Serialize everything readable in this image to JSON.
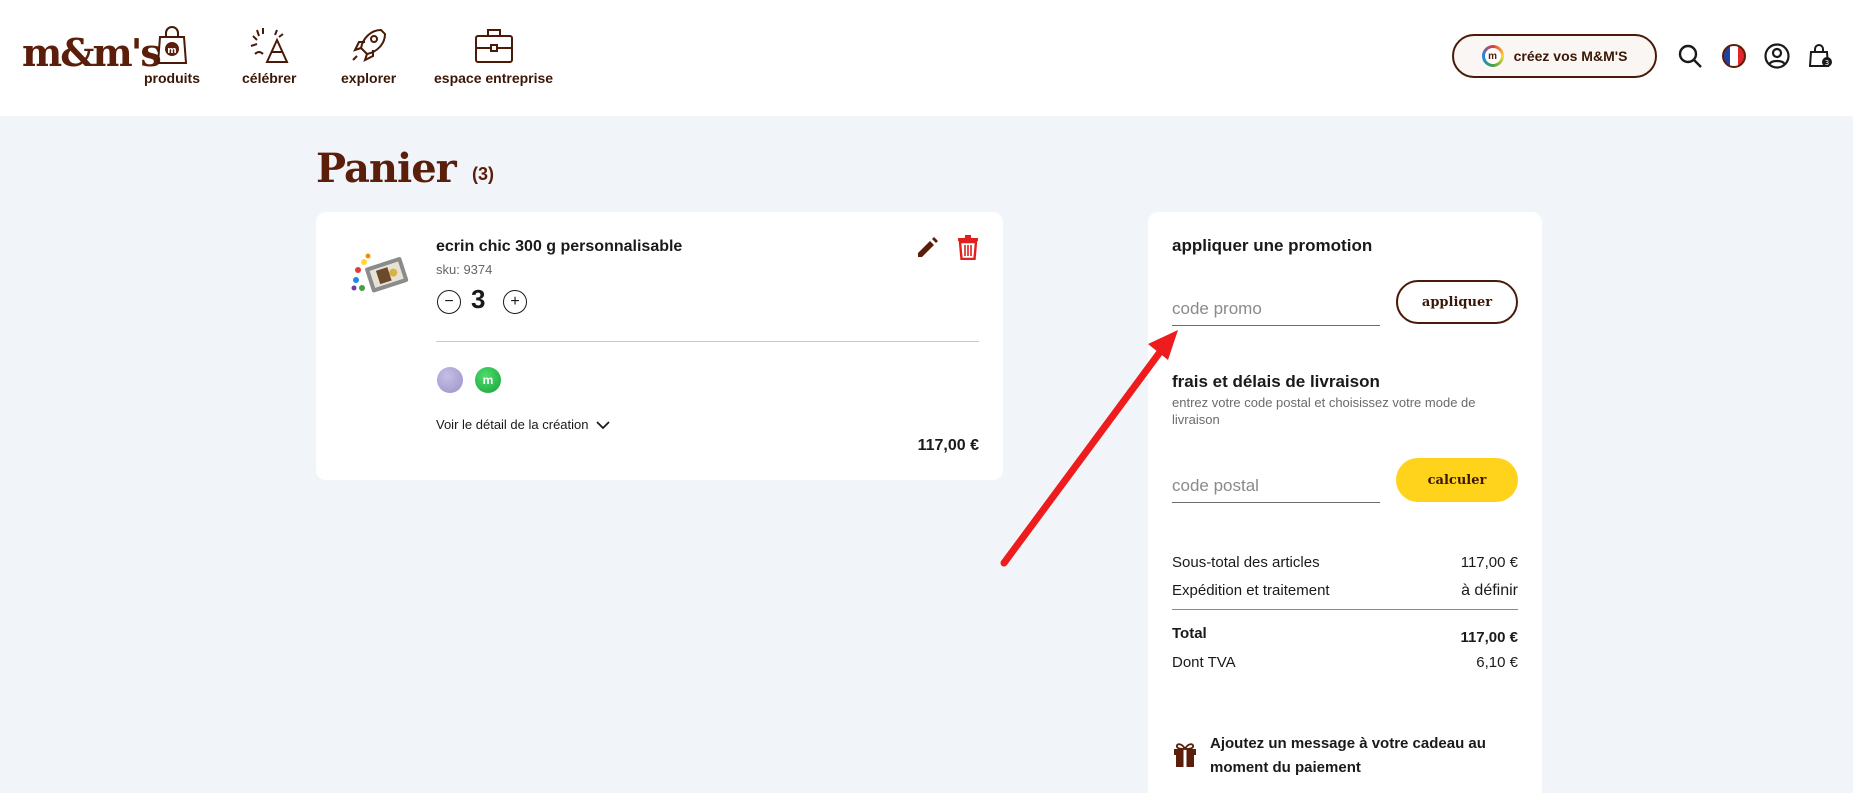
{
  "header": {
    "logo": "m&m's",
    "nav": [
      {
        "label": "produits",
        "icon": "shopping-bag-icon"
      },
      {
        "label": "célébrer",
        "icon": "party-popper-icon"
      },
      {
        "label": "explorer",
        "icon": "rocket-icon"
      },
      {
        "label": "espace entreprise",
        "icon": "briefcase-icon"
      }
    ],
    "create_button": "créez vos M&M'S",
    "create_badge": "m",
    "cart_count": "3",
    "icons": [
      "search-icon",
      "french-flag-icon",
      "account-icon",
      "cart-icon"
    ]
  },
  "page": {
    "title": "Panier",
    "count": "(3)"
  },
  "cart": {
    "item": {
      "name": "ecrin chic 300 g personnalisable",
      "sku": "sku: 9374",
      "quantity": "3",
      "minus": "−",
      "plus": "+",
      "swatch_letter": "m",
      "detail_link": "Voir le détail de la création",
      "price": "117,00 €"
    }
  },
  "summary": {
    "promo_title": "appliquer une promotion",
    "promo_placeholder": "code promo",
    "apply_label": "appliquer",
    "shipping_title": "frais et délais de livraison",
    "shipping_subtitle": "entrez votre code postal et choisissez votre mode de livraison",
    "postal_placeholder": "code postal",
    "calculate_label": "calculer",
    "subtotal_label": "Sous-total des articles",
    "subtotal_value": "117,00 €",
    "shipping_label": "Expédition et traitement",
    "shipping_value": "à définir",
    "total_label": "Total",
    "total_value": "117,00 €",
    "tva_label": "Dont TVA",
    "tva_value": "6,10 €",
    "gift_message": "Ajoutez un message à votre cadeau au moment du paiement"
  },
  "colors": {
    "brand_brown": "#5a1e0a",
    "accent_yellow": "#ffd21c",
    "delete_red": "#e0201c",
    "annotation_red": "#ee1c1c",
    "page_bg": "#f1f5fa"
  }
}
